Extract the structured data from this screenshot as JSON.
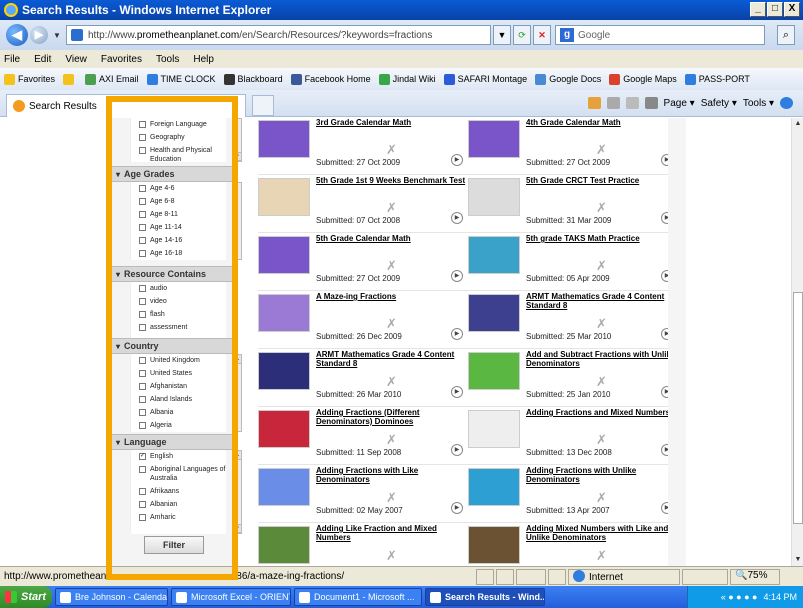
{
  "window": {
    "title": "Search Results - Windows Internet Explorer",
    "min": "_",
    "max": "□",
    "close": "X"
  },
  "address": {
    "url_prefix": "http://www.",
    "url_domain": "prometheanplanet.com",
    "url_rest": "/en/Search/Resources/?keywords=fractions",
    "search_placeholder": "Google",
    "search_logo": "g"
  },
  "menu": [
    "File",
    "Edit",
    "View",
    "Favorites",
    "Tools",
    "Help"
  ],
  "favorites": {
    "label": "Favorites",
    "items": [
      "AXI Email",
      "TIME CLOCK",
      "Blackboard",
      "Facebook Home",
      "Jindal Wiki",
      "SAFARI Montage",
      "Google Docs",
      "Google Maps",
      "PASS-PORT"
    ]
  },
  "tab": {
    "label": "Search Results"
  },
  "commands": [
    "Page ▾",
    "Safety ▾",
    "Tools ▾"
  ],
  "filters": {
    "subject_items": [
      "Foreign Language",
      "Geography",
      "Health and Physical Education"
    ],
    "age": {
      "heading": "Age Grades",
      "items": [
        "Age 4-6",
        "Age 6-8",
        "Age 8-11",
        "Age 11-14",
        "Age 14-16",
        "Age 16-18"
      ]
    },
    "resource": {
      "heading": "Resource Contains",
      "items": [
        "audio",
        "video",
        "flash",
        "assessment"
      ]
    },
    "country": {
      "heading": "Country",
      "items": [
        "United Kingdom",
        "United States",
        "Afghanistan",
        "Aland Islands",
        "Albania",
        "Algeria"
      ]
    },
    "language": {
      "heading": "Language",
      "items": [
        "English",
        "Aboriginal Languages of Australia",
        "Afrikaans",
        "Albanian",
        "Amharic"
      ],
      "checked_index": 0
    },
    "button": "Filter"
  },
  "resources": [
    {
      "title": "3rd Grade Calendar Math",
      "submitted": "Submitted: 27 Oct 2009",
      "thumb": "#7a55c9"
    },
    {
      "title": "4th Grade Calendar Math",
      "submitted": "Submitted: 27 Oct 2009",
      "thumb": "#7a55c9"
    },
    {
      "title": "5th Grade 1st 9 Weeks Benchmark Test",
      "submitted": "Submitted: 07 Oct 2008",
      "thumb": "#e8d5b5"
    },
    {
      "title": "5th Grade CRCT Test Practice",
      "submitted": "Submitted: 31 Mar 2009",
      "thumb": "#dcdcdc"
    },
    {
      "title": "5th Grade Calendar Math",
      "submitted": "Submitted: 27 Oct 2009",
      "thumb": "#7a55c9"
    },
    {
      "title": "5th grade TAKS Math Practice",
      "submitted": "Submitted: 05 Apr 2009",
      "thumb": "#3aa2c9"
    },
    {
      "title": "A Maze-ing Fractions",
      "submitted": "Submitted: 26 Dec 2009",
      "thumb": "#9b7ad6"
    },
    {
      "title": "ARMT Mathematics Grade 4 Content Standard 8",
      "submitted": "Submitted: 25 Mar 2010",
      "thumb": "#3d3f8f"
    },
    {
      "title": "ARMT Mathematics Grade 4 Content Standard 8",
      "submitted": "Submitted: 26 Mar 2010",
      "thumb": "#2c2e7a"
    },
    {
      "title": "Add and Subtract Fractions with Unlike Denominators",
      "submitted": "Submitted: 25 Jan 2010",
      "thumb": "#5ab842"
    },
    {
      "title": "Adding Fractions (Different Denominators) Dominoes",
      "submitted": "Submitted: 11 Sep 2008",
      "thumb": "#c8263b"
    },
    {
      "title": "Adding Fractions and Mixed Numbers",
      "submitted": "Submitted: 13 Dec 2008",
      "thumb": "#eeeeee"
    },
    {
      "title": "Adding Fractions with Like Denominators",
      "submitted": "Submitted: 02 May 2007",
      "thumb": "#6a8de8"
    },
    {
      "title": "Adding Fractions with Unlike Denominators",
      "submitted": "Submitted: 13 Apr 2007",
      "thumb": "#2e9fd3"
    },
    {
      "title": "Adding Like Fraction and Mixed Numbers",
      "submitted": "",
      "thumb": "#5a8a3a"
    },
    {
      "title": "Adding Mixed Numbers with Like and Unlike Denominators",
      "submitted": "",
      "thumb": "#6b5233"
    }
  ],
  "status": {
    "url": "http://www.promethean",
    "url_tail": "86/a-maze-ing-fractions/",
    "zone": "Internet",
    "zoom": "75%"
  },
  "taskbar": {
    "start": "Start",
    "tasks": [
      "Bre Johnson - Calendar -...",
      "Microsoft Excel - ORIENT...",
      "Document1 - Microsoft ...",
      "Search Results - Wind..."
    ],
    "clock": "4:14 PM"
  }
}
